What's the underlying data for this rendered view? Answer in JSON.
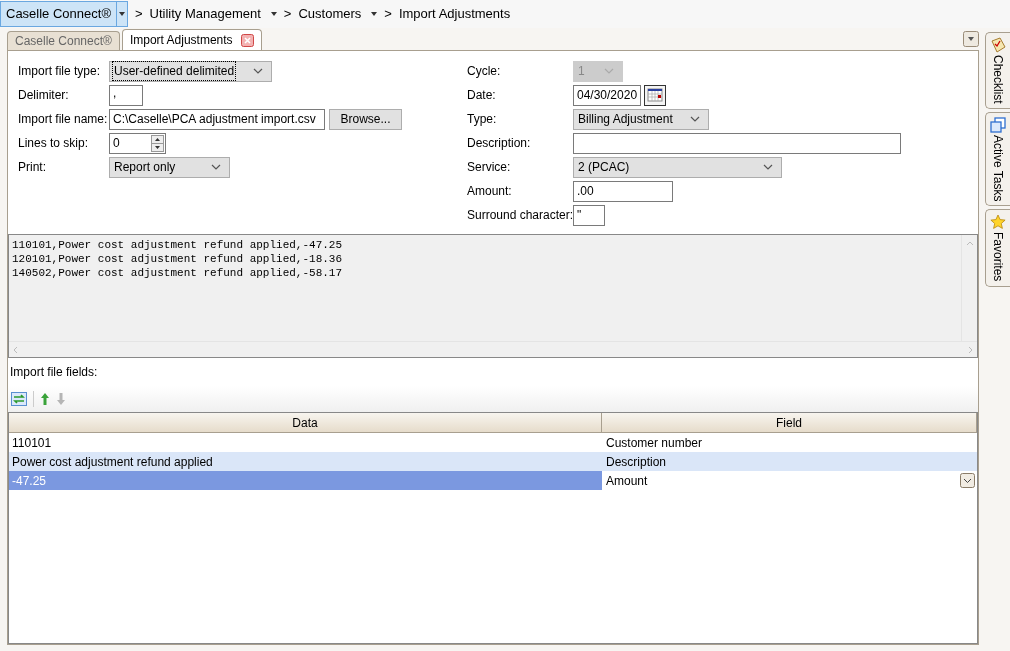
{
  "breadcrumb": {
    "home": "Caselle Connect®",
    "items": [
      {
        "label": "Utility Management",
        "dropdown": true
      },
      {
        "label": "Customers",
        "dropdown": true
      },
      {
        "label": "Import Adjustments",
        "dropdown": false
      }
    ],
    "separator": ">"
  },
  "tabs": [
    {
      "label": "Caselle Connect®",
      "selected": false,
      "closable": false
    },
    {
      "label": "Import Adjustments",
      "selected": true,
      "closable": true
    }
  ],
  "left_fields": [
    {
      "label": "Import file type:",
      "kind": "select",
      "value": "User-defined delimited",
      "focused": true
    },
    {
      "label": "Delimiter:",
      "kind": "text",
      "value": ","
    },
    {
      "label": "Import file name:",
      "kind": "file",
      "value": "C:\\Caselle\\PCA adjustment import.csv",
      "button": "Browse..."
    },
    {
      "label": "Lines to skip:",
      "kind": "spin",
      "value": "0"
    },
    {
      "label": "Print:",
      "kind": "select",
      "value": "Report only",
      "focused": false
    }
  ],
  "right_fields": [
    {
      "label": "Cycle:",
      "kind": "select",
      "value": "1",
      "disabled": true
    },
    {
      "label": "Date:",
      "kind": "date",
      "value": "04/30/2020"
    },
    {
      "label": "Type:",
      "kind": "select",
      "value": "Billing Adjustment",
      "disabled": false
    },
    {
      "label": "Description:",
      "kind": "text"
    },
    {
      "label": "Service:",
      "kind": "select",
      "value": "2 (PCAC)",
      "disabled": false
    },
    {
      "label": "Amount:",
      "kind": "text",
      "value": ".00"
    },
    {
      "label": "Surround character:",
      "kind": "text",
      "value": "\""
    }
  ],
  "preview_lines": [
    "110101,Power cost adjustment refund applied,-47.25",
    "120101,Power cost adjustment refund applied,-18.36",
    "140502,Power cost adjustment refund applied,-58.17"
  ],
  "fields_label": "Import file fields:",
  "table": {
    "columns": [
      "Data",
      "Field"
    ],
    "rows": [
      {
        "data": "110101",
        "field": "Customer number",
        "hovered": false,
        "selected": false
      },
      {
        "data": "Power cost adjustment refund applied",
        "field": "Description",
        "hovered": true,
        "selected": false
      },
      {
        "data": "-47.25",
        "field": "Amount",
        "hovered": false,
        "selected": true
      }
    ]
  },
  "side_tabs": [
    {
      "label": "Checklist"
    },
    {
      "label": "Active Tasks"
    },
    {
      "label": "Favorites"
    }
  ]
}
